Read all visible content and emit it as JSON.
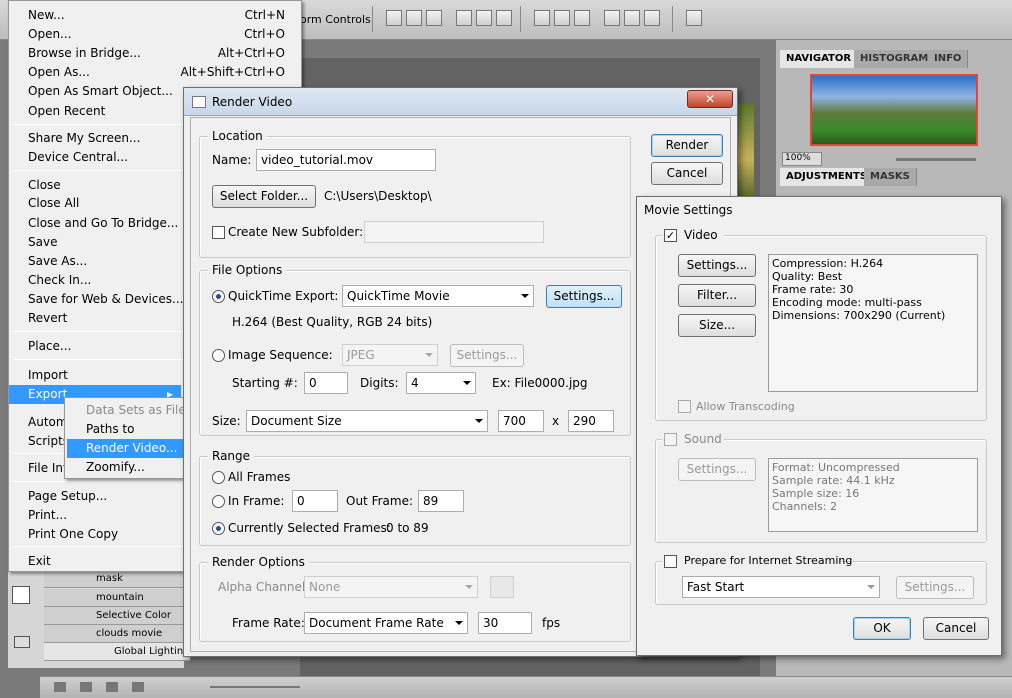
{
  "app": {
    "toolbar_text": "orm Controls"
  },
  "file_menu": {
    "items": [
      {
        "label": "New...",
        "shortcut": "Ctrl+N"
      },
      {
        "label": "Open...",
        "shortcut": "Ctrl+O"
      },
      {
        "label": "Browse in Bridge...",
        "shortcut": "Alt+Ctrl+O"
      },
      {
        "label": "Open As...",
        "shortcut": "Alt+Shift+Ctrl+O"
      },
      {
        "label": "Open As Smart Object...",
        "shortcut": ""
      },
      {
        "label": "Open Recent",
        "shortcut": ""
      },
      {
        "label": "Share My Screen...",
        "shortcut": ""
      },
      {
        "label": "Device Central...",
        "shortcut": ""
      },
      {
        "label": "Close",
        "shortcut": ""
      },
      {
        "label": "Close All",
        "shortcut": ""
      },
      {
        "label": "Close and Go To Bridge...",
        "shortcut": ""
      },
      {
        "label": "Save",
        "shortcut": ""
      },
      {
        "label": "Save As...",
        "shortcut": ""
      },
      {
        "label": "Check In...",
        "shortcut": ""
      },
      {
        "label": "Save for Web & Devices...",
        "shortcut": ""
      },
      {
        "label": "Revert",
        "shortcut": ""
      },
      {
        "label": "Place...",
        "shortcut": ""
      },
      {
        "label": "Import",
        "shortcut": ""
      },
      {
        "label": "Export",
        "shortcut": ""
      },
      {
        "label": "Autom",
        "shortcut": ""
      },
      {
        "label": "Scripts",
        "shortcut": ""
      },
      {
        "label": "File Info",
        "shortcut": ""
      },
      {
        "label": "Page Setup...",
        "shortcut": ""
      },
      {
        "label": "Print...",
        "shortcut": ""
      },
      {
        "label": "Print One Copy",
        "shortcut": ""
      },
      {
        "label": "Exit",
        "shortcut": ""
      }
    ]
  },
  "export_submenu": {
    "items": [
      "Data Sets as Files...",
      "Paths to Illustrator...",
      "Render Video...",
      "Zoomify..."
    ]
  },
  "layers": {
    "rows": [
      "mask",
      "mountain",
      "Selective Color",
      "clouds movie",
      "Global Lightin"
    ]
  },
  "right_panel": {
    "tabs_top": [
      "NAVIGATOR",
      "HISTOGRAM",
      "INFO"
    ],
    "zoom": "100%",
    "tabs_mid": [
      "ADJUSTMENTS",
      "MASKS"
    ]
  },
  "render_video": {
    "title": "Render Video",
    "location_label": "Location",
    "name_label": "Name:",
    "name_value": "video_tutorial.mov",
    "select_folder": "Select Folder...",
    "folder_path": "C:\\Users\\Desktop\\",
    "create_subfolder": "Create New Subfolder:",
    "render_btn": "Render",
    "cancel_btn": "Cancel",
    "file_options_label": "File Options",
    "qt_export": "QuickTime Export:",
    "qt_format": "QuickTime Movie",
    "settings_btn": "Settings...",
    "qt_desc": "H.264 (Best Quality, RGB 24 bits)",
    "image_sequence": "Image Sequence:",
    "img_format": "JPEG",
    "starting_label": "Starting #:",
    "starting_value": "0",
    "digits_label": "Digits:",
    "digits_value": "4",
    "example": "Ex: File0000.jpg",
    "size_label": "Size:",
    "size_value": "Document Size",
    "width": "700",
    "x": "x",
    "height": "290",
    "range_label": "Range",
    "all_frames": "All Frames",
    "in_frame": "In Frame:",
    "in_value": "0",
    "out_frame": "Out Frame:",
    "out_value": "89",
    "current_frames": "Currently Selected Frames:",
    "current_range": "0 to 89",
    "render_options": "Render Options",
    "alpha_label": "Alpha Channel:",
    "alpha_value": "None",
    "frame_rate_label": "Frame Rate:",
    "frame_rate_value": "Document Frame Rate",
    "fps_value": "30",
    "fps": "fps"
  },
  "movie_settings": {
    "title": "Movie Settings",
    "video_label": "Video",
    "settings_btn": "Settings...",
    "filter_btn": "Filter...",
    "size_btn": "Size...",
    "video_info": [
      "Compression: H.264",
      "Quality: Best",
      "Frame rate: 30",
      "Encoding mode: multi-pass",
      "Dimensions: 700x290 (Current)"
    ],
    "allow_transcoding": "Allow Transcoding",
    "sound_label": "Sound",
    "sound_settings_btn": "Settings...",
    "sound_info": [
      "Format: Uncompressed",
      "Sample rate: 44.1 kHz",
      "Sample size: 16",
      "Channels: 2"
    ],
    "prepare_streaming": "Prepare for Internet Streaming",
    "streaming_value": "Fast Start",
    "streaming_settings_btn": "Settings...",
    "ok_btn": "OK",
    "cancel_btn": "Cancel"
  }
}
